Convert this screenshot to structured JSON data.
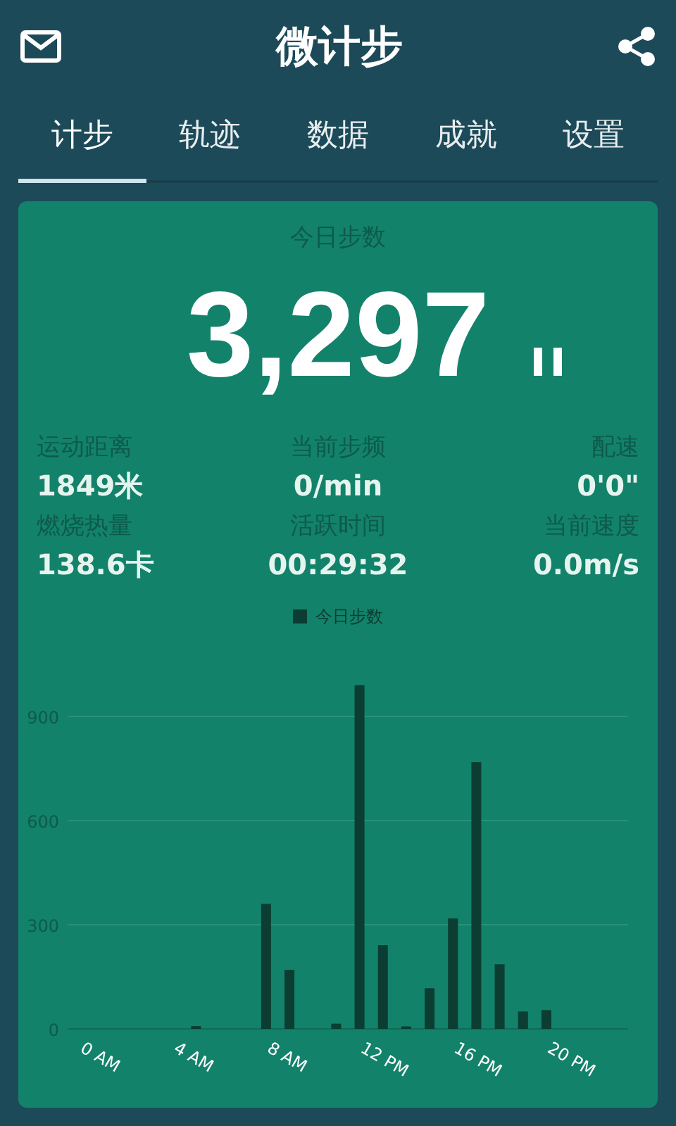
{
  "app_bar": {
    "title": "微计步"
  },
  "tabs": [
    {
      "label": "计步",
      "selected": true
    },
    {
      "label": "轨迹",
      "selected": false
    },
    {
      "label": "数据",
      "selected": false
    },
    {
      "label": "成就",
      "selected": false
    },
    {
      "label": "设置",
      "selected": false
    }
  ],
  "card": {
    "caption": "今日步数",
    "steps": "3,297",
    "paused": true,
    "stats": [
      {
        "label": "运动距离",
        "value": "1849米"
      },
      {
        "label": "当前步频",
        "value": "0/min"
      },
      {
        "label": "配速",
        "value": "0'0\""
      },
      {
        "label": "燃烧热量",
        "value": "138.6卡"
      },
      {
        "label": "活跃时间",
        "value": "00:29:32"
      },
      {
        "label": "当前速度",
        "value": "0.0m/s"
      }
    ],
    "chart_data": {
      "type": "bar",
      "x": [
        0,
        1,
        2,
        3,
        4,
        5,
        6,
        7,
        8,
        9,
        10,
        11,
        12,
        13,
        14,
        15,
        16,
        17,
        18,
        19,
        20,
        21,
        22,
        23
      ],
      "series": [
        {
          "name": "今日步数",
          "color": "#0b3d33",
          "values": [
            0,
            0,
            0,
            0,
            0,
            8,
            0,
            0,
            360,
            170,
            0,
            15,
            990,
            241,
            7,
            117,
            318,
            768,
            186,
            50,
            54,
            0,
            0,
            0
          ]
        }
      ],
      "xlim": [
        -0.5,
        23.5
      ],
      "ylim": [
        0,
        1000
      ],
      "grid": true,
      "yticks": [
        0,
        300,
        600,
        900
      ],
      "xticks": [
        {
          "value": 0,
          "label": "0 AM"
        },
        {
          "value": 4,
          "label": "4 AM"
        },
        {
          "value": 8,
          "label": "8 AM"
        },
        {
          "value": 12,
          "label": "12 PM"
        },
        {
          "value": 16,
          "label": "16 PM"
        },
        {
          "value": 20,
          "label": "20 PM"
        }
      ]
    }
  }
}
